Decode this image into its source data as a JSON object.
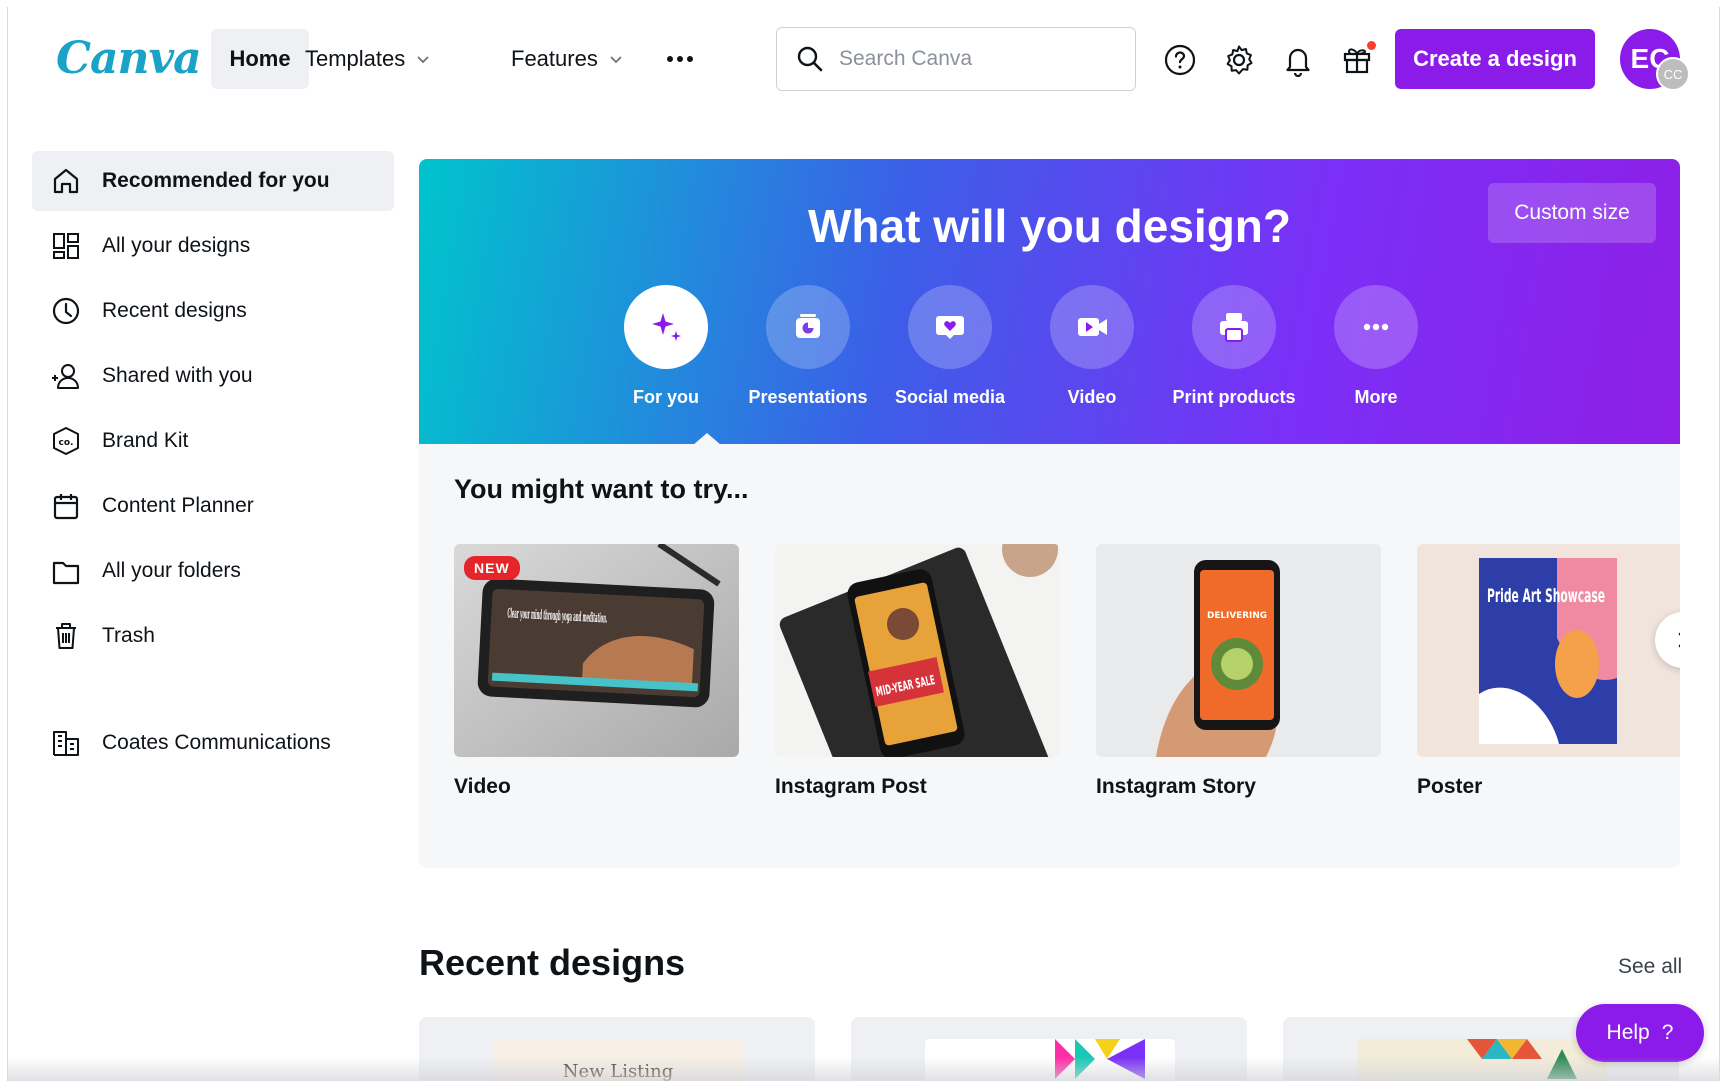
{
  "header": {
    "logo": "Canva",
    "nav_home": "Home",
    "nav_templates": "Templates",
    "nav_features": "Features",
    "search_placeholder": "Search Canva",
    "create_button": "Create a design",
    "avatar_initials": "EC",
    "avatar_badge": "CC"
  },
  "sidebar": {
    "items": [
      {
        "label": "Recommended for you",
        "icon": "home-icon"
      },
      {
        "label": "All your designs",
        "icon": "grid-icon"
      },
      {
        "label": "Recent designs",
        "icon": "clock-icon"
      },
      {
        "label": "Shared with you",
        "icon": "people-icon"
      },
      {
        "label": "Brand Kit",
        "icon": "brand-kit-icon"
      },
      {
        "label": "Content Planner",
        "icon": "calendar-icon"
      },
      {
        "label": "All your folders",
        "icon": "folder-icon"
      },
      {
        "label": "Trash",
        "icon": "trash-icon"
      }
    ],
    "team": {
      "label": "Coates Communications",
      "icon": "building-icon"
    }
  },
  "hero": {
    "title": "What will you design?",
    "custom_size": "Custom size",
    "categories": [
      {
        "label": "For you",
        "icon": "sparkle-icon"
      },
      {
        "label": "Presentations",
        "icon": "presentation-icon"
      },
      {
        "label": "Social media",
        "icon": "heart-icon"
      },
      {
        "label": "Video",
        "icon": "video-icon"
      },
      {
        "label": "Print products",
        "icon": "printer-icon"
      },
      {
        "label": "More",
        "icon": "more-icon"
      }
    ]
  },
  "try_section": {
    "title": "You might want to try...",
    "badge": "NEW",
    "cards": [
      {
        "label": "Video",
        "thumb_text": "Clear your mind through yoga and meditation."
      },
      {
        "label": "Instagram Post",
        "thumb_text": "MID-YEAR SALE"
      },
      {
        "label": "Instagram Story",
        "thumb_text": "DELIVERING"
      },
      {
        "label": "Poster",
        "thumb_text": "Pride Art Showcase"
      }
    ]
  },
  "recent": {
    "title": "Recent designs",
    "see_all": "See all",
    "first_thumb_text": "New Listing"
  },
  "help": {
    "label": "Help",
    "glyph": "?"
  },
  "colors": {
    "brand_purple": "#8b1be8",
    "hero_start": "#00c4cc",
    "hero_end": "#8e1fe6",
    "logo": "#1aa3c7"
  }
}
